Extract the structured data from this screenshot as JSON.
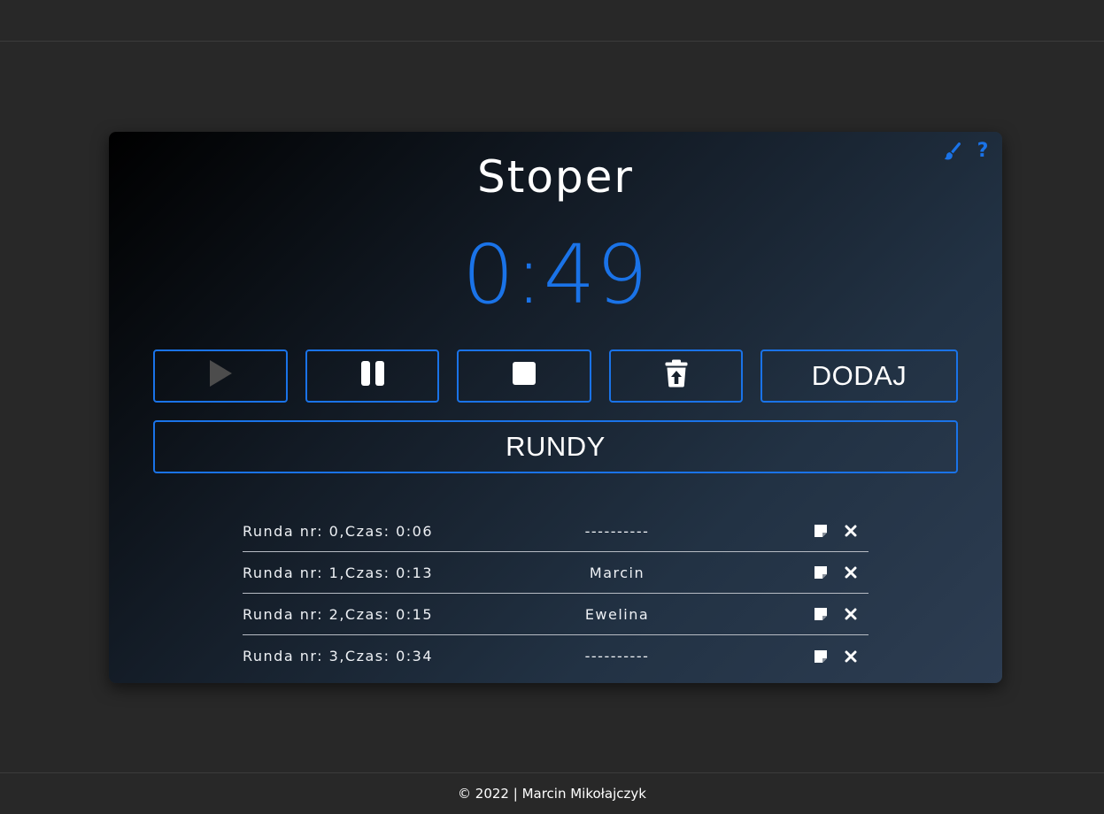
{
  "app": {
    "title": "Stoper",
    "timer": "0:49"
  },
  "controls": {
    "add_label": "DODAJ",
    "rounds_label": "RUNDY",
    "icons": [
      "play-icon",
      "pause-icon",
      "stop-icon",
      "trash-icon",
      "paintbrush-icon",
      "question-icon"
    ],
    "accent_color": "#1a73e8"
  },
  "header_icons": {
    "help_glyph": "?"
  },
  "rounds": [
    {
      "label": "Runda nr: 0,Czas: 0:06",
      "name": "----------"
    },
    {
      "label": "Runda nr: 1,Czas: 0:13",
      "name": "Marcin"
    },
    {
      "label": "Runda nr: 2,Czas: 0:15",
      "name": "Ewelina"
    },
    {
      "label": "Runda nr: 3,Czas: 0:34",
      "name": "----------"
    }
  ],
  "footer": {
    "text": "© 2022 | Marcin Mikołajczyk"
  }
}
